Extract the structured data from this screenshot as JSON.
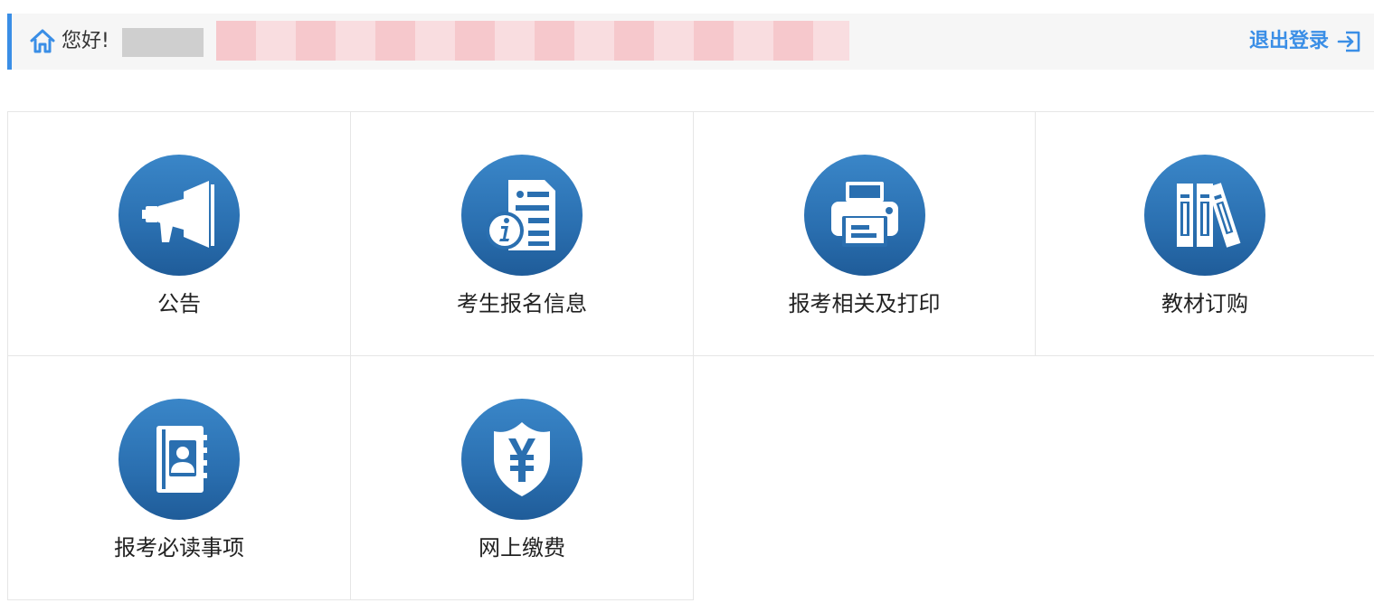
{
  "header": {
    "greeting": "您好!",
    "logout_label": "退出登录",
    "accent_color": "#3a8ee6"
  },
  "tiles": [
    {
      "label": "公告",
      "icon": "megaphone-icon"
    },
    {
      "label": "考生报名信息",
      "icon": "info-document-icon"
    },
    {
      "label": "报考相关及打印",
      "icon": "printer-icon"
    },
    {
      "label": "教材订购",
      "icon": "books-icon"
    },
    {
      "label": "报考必读事项",
      "icon": "contact-book-icon"
    },
    {
      "label": "网上缴费",
      "icon": "yuan-shield-icon"
    }
  ]
}
